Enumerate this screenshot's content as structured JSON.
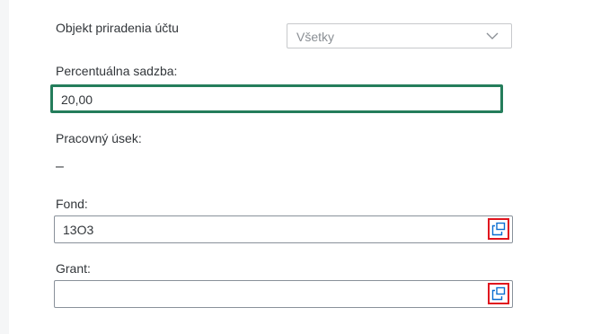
{
  "form": {
    "assignment_object": {
      "label": "Objekt priradenia účtu",
      "selected": "Všetky",
      "icon": "chevron-down-icon"
    },
    "percentage_rate": {
      "label": "Percentuálna sadzba:",
      "value": "20,00"
    },
    "work_segment": {
      "label": "Pracovný úsek:",
      "value": "–"
    },
    "fund": {
      "label": "Fond:",
      "value": "13O3",
      "icon": "value-help-icon"
    },
    "grant": {
      "label": "Grant:",
      "value": "",
      "icon": "value-help-icon"
    }
  },
  "colors": {
    "focus_border": "#247d5b",
    "highlight": "#e0141e",
    "icon": "#0a6ed1"
  }
}
